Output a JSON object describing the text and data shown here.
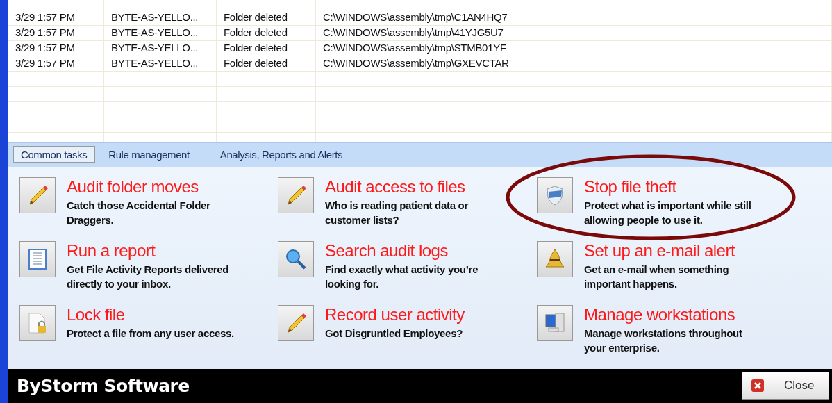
{
  "log_table": {
    "rows": [
      {
        "cells": [
          "3/29 1:57 PM",
          "BYTE-AS-YELLO...",
          "Folder deleted",
          "C:\\WINDOWS\\assembly\\tmp\\C1AN4HQ7"
        ]
      },
      {
        "cells": [
          "3/29 1:57 PM",
          "BYTE-AS-YELLO...",
          "Folder deleted",
          "C:\\WINDOWS\\assembly\\tmp\\41YJG5U7"
        ]
      },
      {
        "cells": [
          "3/29 1:57 PM",
          "BYTE-AS-YELLO...",
          "Folder deleted",
          "C:\\WINDOWS\\assembly\\tmp\\STMB01YF"
        ]
      },
      {
        "cells": [
          "3/29 1:57 PM",
          "BYTE-AS-YELLO...",
          "Folder deleted",
          "C:\\WINDOWS\\assembly\\tmp\\GXEVCTAR"
        ]
      }
    ]
  },
  "tabs": [
    {
      "label": "Common tasks",
      "selected": true
    },
    {
      "label": "Rule management",
      "selected": false
    },
    {
      "label": "Analysis, Reports and Alerts",
      "selected": false
    }
  ],
  "tasks": [
    {
      "kind": "pencil",
      "title": "Audit folder moves",
      "description": "Catch those Accidental Folder Draggers."
    },
    {
      "kind": "pencil",
      "title": "Audit access to files",
      "description": "Who is reading patient data or customer lists?"
    },
    {
      "kind": "shield",
      "title": "Stop file theft",
      "description": "Protect what is important while still allowing people to use it."
    },
    {
      "kind": "report",
      "title": "Run a report",
      "description": "Get File Activity Reports delivered directly to your inbox."
    },
    {
      "kind": "magnifier",
      "title": "Search audit logs",
      "description": "Find exactly what activity you’re looking for."
    },
    {
      "kind": "bell",
      "title": "Set up an e-mail alert",
      "description": "Get an e-mail when something important happens."
    },
    {
      "kind": "lock",
      "title": "Lock file",
      "description": "Protect a file from any user access."
    },
    {
      "kind": "pencil",
      "title": "Record user activity",
      "description": "Got Disgruntled Employees?"
    },
    {
      "kind": "monitor",
      "title": "Manage workstations",
      "description": "Manage workstations throughout your enterprise."
    }
  ],
  "footer": {
    "brand": "ByStorm Software",
    "close_button": "Close"
  }
}
